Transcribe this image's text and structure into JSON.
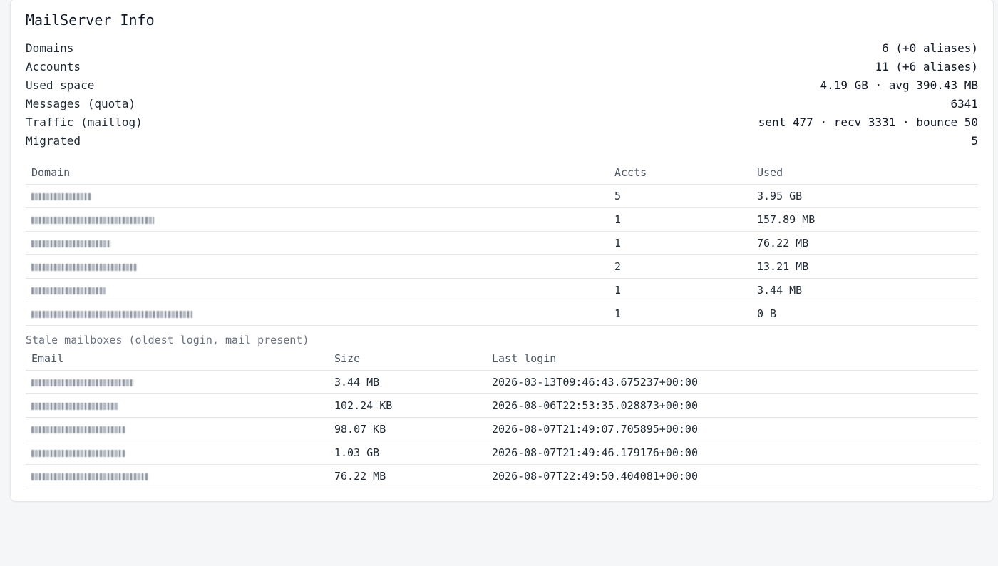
{
  "title": "MailServer Info",
  "stats": [
    {
      "label": "Domains",
      "value": "6 (+0 aliases)"
    },
    {
      "label": "Accounts",
      "value": "11 (+6 aliases)"
    },
    {
      "label": "Used space",
      "value": "4.19 GB · avg 390.43 MB"
    },
    {
      "label": "Messages (quota)",
      "value": "6341"
    },
    {
      "label": "Traffic (maillog)",
      "value": "sent 477 · recv 3331 · bounce 50"
    },
    {
      "label": "Migrated",
      "value": "5"
    }
  ],
  "domains": {
    "headers": [
      "Domain",
      "Accts",
      "Used"
    ],
    "rows": [
      {
        "accts": "5",
        "used": "3.95 GB"
      },
      {
        "accts": "1",
        "used": "157.89 MB"
      },
      {
        "accts": "1",
        "used": "76.22 MB"
      },
      {
        "accts": "2",
        "used": "13.21 MB"
      },
      {
        "accts": "1",
        "used": "3.44 MB"
      },
      {
        "accts": "1",
        "used": "0 B"
      }
    ]
  },
  "stale_caption": "Stale mailboxes (oldest login, mail present)",
  "mailboxes": {
    "headers": [
      "Email",
      "Size",
      "Last login"
    ],
    "rows": [
      {
        "size": "3.44 MB",
        "last_login": "2026-03-13T09:46:43.675237+00:00"
      },
      {
        "size": "102.24 KB",
        "last_login": "2026-08-06T22:53:35.028873+00:00"
      },
      {
        "size": "98.07 KB",
        "last_login": "2026-08-07T21:49:07.705895+00:00"
      },
      {
        "size": "1.03 GB",
        "last_login": "2026-08-07T21:49:46.179176+00:00"
      },
      {
        "size": "76.22 MB",
        "last_login": "2026-08-07T22:49:50.404081+00:00"
      }
    ]
  }
}
